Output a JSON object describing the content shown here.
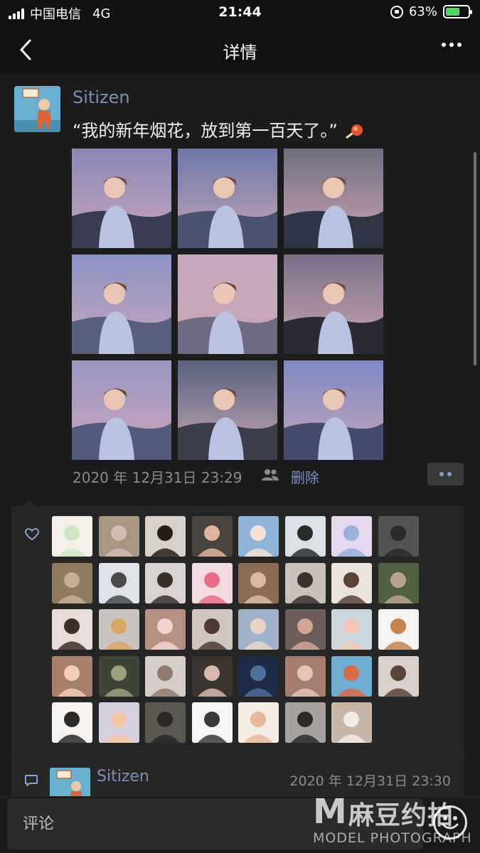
{
  "status_bar": {
    "carrier": "中国电信",
    "network": "4G",
    "time": "21:44",
    "battery": "63%",
    "battery_level": 0.63
  },
  "nav": {
    "title": "详情",
    "back_icon": "chevron-left-icon",
    "more_icon": "ellipsis-icon"
  },
  "post": {
    "author": "Sitizen",
    "text": "“我的新年烟花，放到第一百天了。”",
    "photos": [
      {
        "sky": "#8b87b8",
        "ground": "#3a3d52"
      },
      {
        "sky": "#6c78a8",
        "ground": "#4a5270"
      },
      {
        "sky": "#6f6e80",
        "ground": "#2f3542"
      },
      {
        "sky": "#8a93c6",
        "ground": "#59607e"
      },
      {
        "sky": "#c3a7bd",
        "ground": "#6f6a82"
      },
      {
        "sky": "#7a7086",
        "ground": "#2c2a35"
      },
      {
        "sky": "#9c96c4",
        "ground": "#545a7c"
      },
      {
        "sky": "#58627c",
        "ground": "#3b3d4a"
      },
      {
        "sky": "#7d8ac4",
        "ground": "#454c6b"
      }
    ],
    "timestamp": "2020 年 12月31日 23:29",
    "delete_label": "删除"
  },
  "likes": {
    "avatars": [
      {
        "bg": "#f4efe9",
        "fg": "#cfe7c7"
      },
      {
        "bg": "#a69684",
        "fg": "#cdbfb1"
      },
      {
        "bg": "#d8d0cb",
        "fg": "#2a1e1a"
      },
      {
        "bg": "#4a4440",
        "fg": "#e0b39c"
      },
      {
        "bg": "#8fb3d6",
        "fg": "#f1e3d8"
      },
      {
        "bg": "#dbe0e6",
        "fg": "#2b2b2b"
      },
      {
        "bg": "#e4d7ee",
        "fg": "#9ab0d9"
      },
      {
        "bg": "#545454",
        "fg": "#2a2a2a"
      },
      {
        "bg": "#8f7a62",
        "fg": "#c5ae93"
      },
      {
        "bg": "#dfe2e8",
        "fg": "#4a4a4a"
      },
      {
        "bg": "#d8d3d0",
        "fg": "#3b2f2a"
      },
      {
        "bg": "#f1dbe1",
        "fg": "#ea6f86"
      },
      {
        "bg": "#8d6d58",
        "fg": "#d9b9a4"
      },
      {
        "bg": "#c9c0b8",
        "fg": "#3a3030"
      },
      {
        "bg": "#eae3dc",
        "fg": "#5b4337"
      },
      {
        "bg": "#526042",
        "fg": "#b7a48c"
      },
      {
        "bg": "#e7ddd6",
        "fg": "#3d2e28"
      },
      {
        "bg": "#c9c4bf",
        "fg": "#d8a661"
      },
      {
        "bg": "#b78e86",
        "fg": "#f1d3cf"
      },
      {
        "bg": "#d1c5bf",
        "fg": "#4b3a33"
      },
      {
        "bg": "#9fb2c7",
        "fg": "#e9d3c7"
      },
      {
        "bg": "#6b5e5a",
        "fg": "#d1a793"
      },
      {
        "bg": "#ccd6de",
        "fg": "#f0c7b7"
      },
      {
        "bg": "#f6f4f2",
        "fg": "#c4824e"
      },
      {
        "bg": "#a87e6c",
        "fg": "#f1cdbb"
      },
      {
        "bg": "#3e4536",
        "fg": "#9ea07c"
      },
      {
        "bg": "#d5cdc6",
        "fg": "#8f7a70"
      },
      {
        "bg": "#3c3430",
        "fg": "#d6b9ad"
      },
      {
        "bg": "#1f2c45",
        "fg": "#4d6e9c"
      },
      {
        "bg": "#a37d6f",
        "fg": "#e4c4b5"
      },
      {
        "bg": "#6faed0",
        "fg": "#d76b46"
      },
      {
        "bg": "#d7d0cb",
        "fg": "#5a4338"
      },
      {
        "bg": "#f5f1ee",
        "fg": "#2b2b2b"
      },
      {
        "bg": "#d6cfe0",
        "fg": "#f2c6a2"
      },
      {
        "bg": "#5b5751",
        "fg": "#2a2826"
      },
      {
        "bg": "#f7f6f5",
        "fg": "#3a3a3a"
      },
      {
        "bg": "#f3ede4",
        "fg": "#e7b79c"
      },
      {
        "bg": "#a7a2a0",
        "fg": "#2d2a2a"
      },
      {
        "bg": "#c6b7a8",
        "fg": "#f1ebe4"
      }
    ]
  },
  "comments": [
    {
      "author": "Sitizen",
      "time": "2020 年 12月31日 23:30"
    }
  ],
  "comment_bar": {
    "placeholder": "评论",
    "emoji_icon": "smiley-icon"
  },
  "watermark": {
    "logo": "M",
    "cn": "麻豆约拍",
    "en": "MODEL PHOTOGRAPH"
  },
  "colors": {
    "link": "#7b8fb8",
    "battery_fill": "#4cd964",
    "background": "#1c1c1c"
  }
}
